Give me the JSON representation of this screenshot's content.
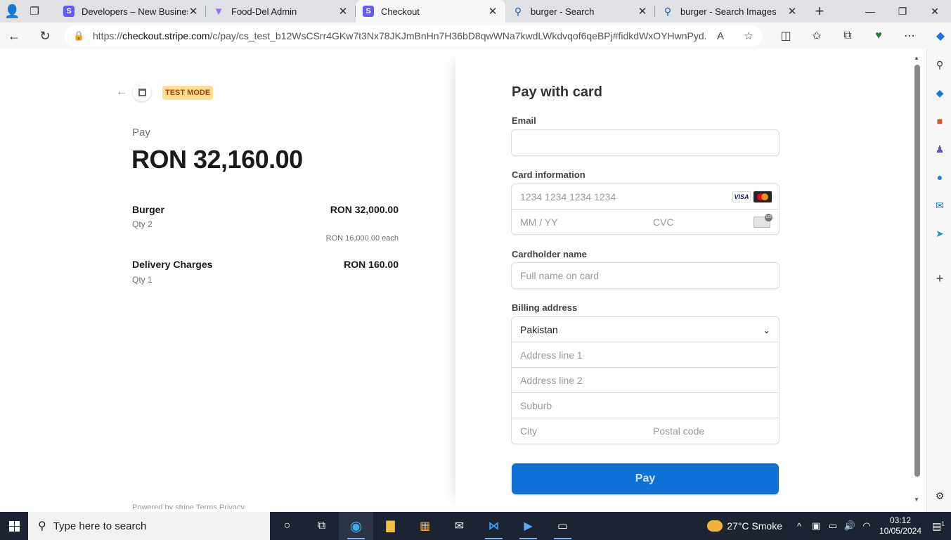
{
  "browser": {
    "tabs": [
      {
        "title": "Developers – New Business",
        "icon": "stripe-icon",
        "active": false
      },
      {
        "title": "Food-Del Admin",
        "icon": "vite-icon",
        "active": false
      },
      {
        "title": "Checkout",
        "icon": "stripe-icon",
        "active": true
      },
      {
        "title": "burger - Search",
        "icon": "search-icon",
        "active": false
      },
      {
        "title": "burger - Search Images",
        "icon": "search-icon",
        "active": false
      }
    ],
    "url_prefix": "https://",
    "url_host": "checkout.stripe.com",
    "url_path": "/c/pay/cs_test_b12WsCSrr4GKw7t3Nx78JKJmBnHn7H36bD8qwWNa7kwdLWkdvqof6qeBPj#fidkdWxOYHwnPyd..."
  },
  "summary": {
    "test_mode": "TEST MODE",
    "pay_label": "Pay",
    "total": "RON 32,160.00",
    "items": [
      {
        "name": "Burger",
        "qty": "Qty 2",
        "price": "RON 32,000.00",
        "each": "RON 16,000.00 each"
      },
      {
        "name": "Delivery Charges",
        "qty": "Qty 1",
        "price": "RON 160.00",
        "each": ""
      }
    ],
    "footer": "Powered by stripe    Terms  Privacy"
  },
  "form": {
    "title": "Pay with card",
    "email_label": "Email",
    "email_value": "",
    "card_label": "Card information",
    "card_number_placeholder": "1234 1234 1234 1234",
    "expiry_placeholder": "MM / YY",
    "cvc_placeholder": "CVC",
    "card_brands": [
      "VISA",
      "Mastercard"
    ],
    "name_label": "Cardholder name",
    "name_placeholder": "Full name on card",
    "billing_label": "Billing address",
    "country": "Pakistan",
    "address1_placeholder": "Address line 1",
    "address2_placeholder": "Address line 2",
    "suburb_placeholder": "Suburb",
    "city_placeholder": "City",
    "postal_placeholder": "Postal code",
    "pay_button": "Pay",
    "pay_button_color": "#0f70d5"
  },
  "taskbar": {
    "search_placeholder": "Type here to search",
    "weather": "27°C  Smoke",
    "time": "03:12",
    "date": "10/05/2024",
    "notification_count": "1"
  }
}
